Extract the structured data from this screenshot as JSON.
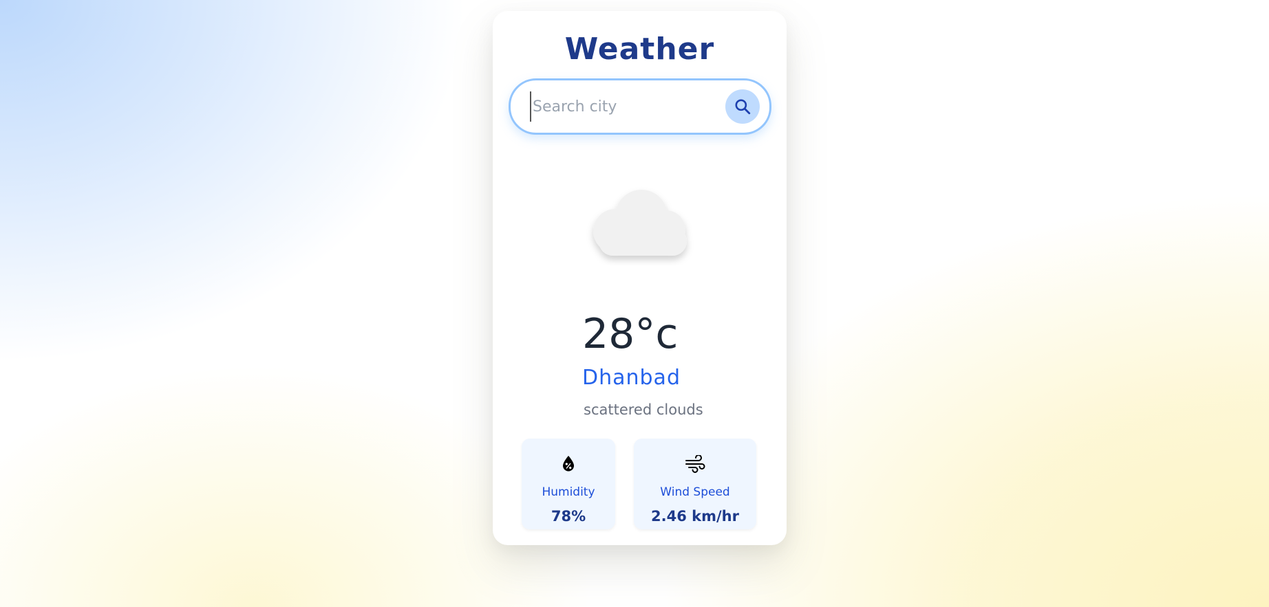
{
  "app": {
    "title": "Weather"
  },
  "search": {
    "placeholder": "Search city",
    "value": ""
  },
  "weather": {
    "icon": "cloud-icon",
    "temperature": "28°c",
    "city": "Dhanbad",
    "description": "scattered clouds"
  },
  "stats": {
    "humidity": {
      "icon": "humidity-icon",
      "label": "Humidity",
      "value": "78%"
    },
    "wind": {
      "icon": "wind-icon",
      "label": "Wind Speed",
      "value": "2.46 km/hr"
    }
  },
  "colors": {
    "title": "#1e3a8a",
    "accent": "#2563eb",
    "search_border": "#93c5fd",
    "search_button": "#bfdbfe",
    "stat_bg": "#eff6ff"
  }
}
